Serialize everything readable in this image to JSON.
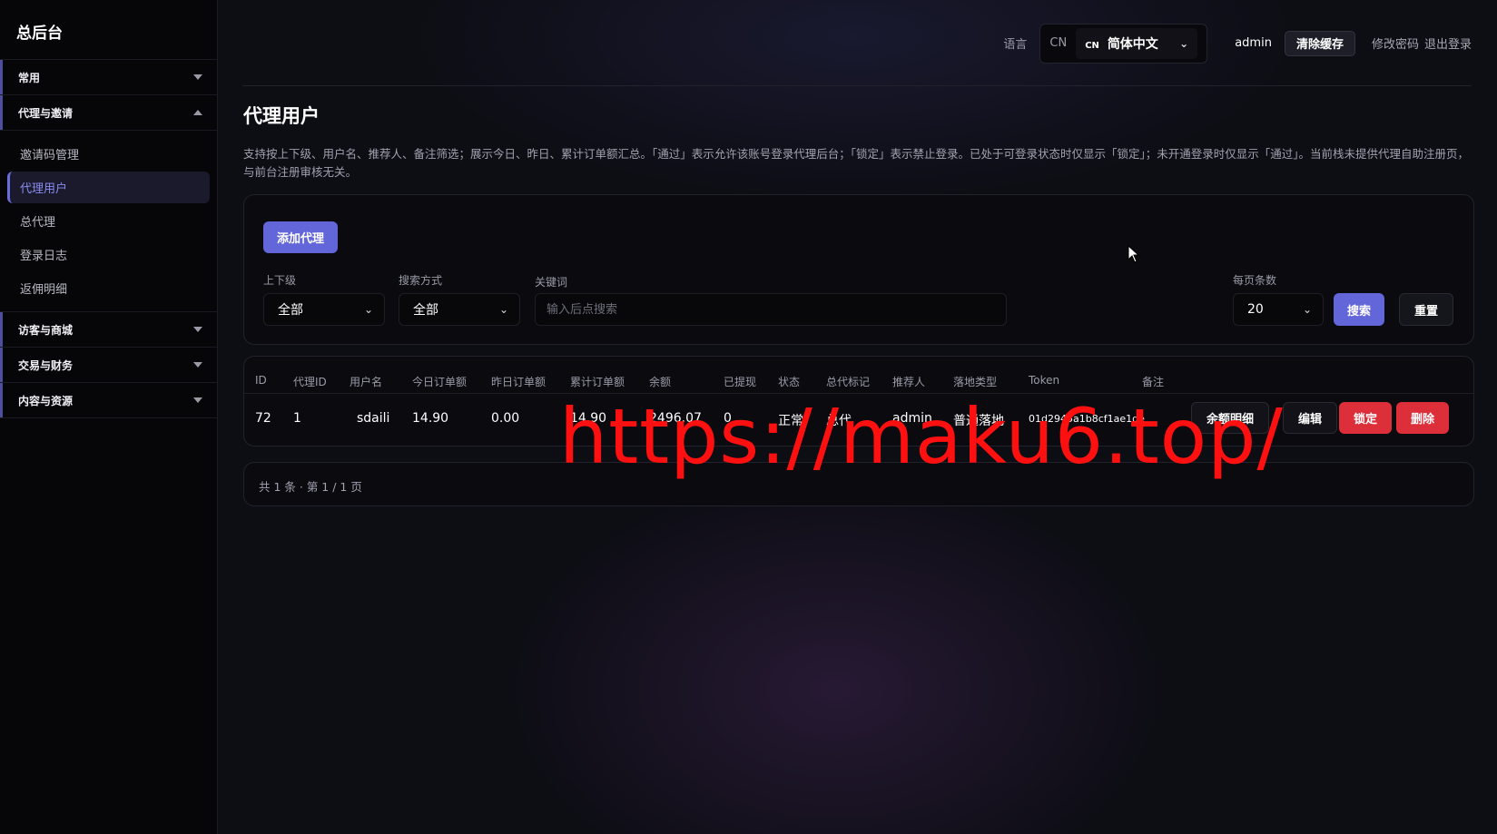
{
  "brand": "总后台",
  "sidebar": {
    "group_common": "常用",
    "group_agent": "代理与邀请",
    "agent_items": [
      "邀请码管理",
      "代理用户",
      "总代理",
      "登录日志",
      "返佣明细"
    ],
    "group_visitor": "访客与商城",
    "group_trade": "交易与财务",
    "group_content": "内容与资源"
  },
  "topbar": {
    "lang_label": "语言",
    "lang_prefix": "CN",
    "lang_select_small": "CN",
    "lang_select_value": "简体中文",
    "user": "admin",
    "clear_cache": "清除缓存",
    "change_password": "修改密码",
    "logout": "退出登录"
  },
  "page": {
    "title": "代理用户",
    "description": "支持按上下级、用户名、推荐人、备注筛选；展示今日、昨日、累计订单额汇总。「通过」表示允许该账号登录代理后台；「锁定」表示禁止登录。已处于可登录状态时仅显示「锁定」；未开通登录时仅显示「通过」。当前栈未提供代理自助注册页，与前台注册审核无关。"
  },
  "filters": {
    "add_button": "添加代理",
    "level_label": "上下级",
    "level_value": "全部",
    "mode_label": "搜索方式",
    "mode_value": "全部",
    "keyword_label": "关键词",
    "keyword_placeholder": "输入后点搜索",
    "page_size_label": "每页条数",
    "page_size_value": "20",
    "search_button": "搜索",
    "reset_button": "重置"
  },
  "table": {
    "headers": [
      "ID",
      "代理ID",
      "用户名",
      "今日订单额",
      "昨日订单额",
      "累计订单额",
      "余额",
      "已提现",
      "状态",
      "总代标记",
      "推荐人",
      "落地类型",
      "Token",
      "备注"
    ],
    "rows": [
      {
        "id": "72",
        "agent_id": "1",
        "username": "sdaili",
        "today": "14.90",
        "yesterday": "0.00",
        "total": "14.90",
        "balance": "2496.07",
        "withdrawn": "0",
        "status": "正常",
        "top_flag": "总代",
        "referrer": "admin",
        "landing": "普通落地",
        "token": "01d2945a1b8cf1ae1de",
        "note": "",
        "actions": [
          "余额明细",
          "编辑",
          "锁定",
          "删除"
        ]
      }
    ]
  },
  "pager": {
    "text": "共 1 条 · 第 1 / 1 页"
  },
  "watermark": "https://maku6.top/",
  "colors": {
    "accent": "#6366d9",
    "danger": "#dc2f3a",
    "watermark": "#ff1010"
  }
}
